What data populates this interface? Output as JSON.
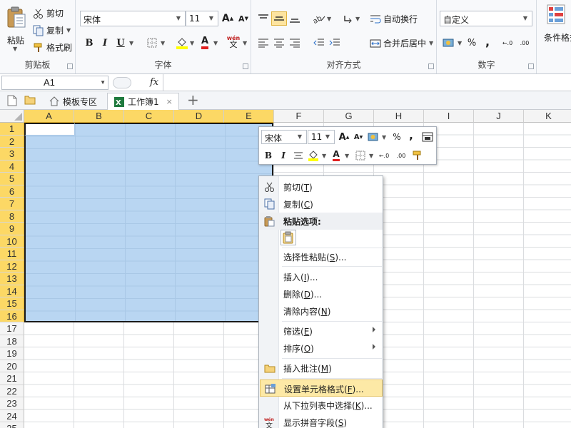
{
  "ribbon": {
    "clipboard": {
      "paste_label": "粘贴",
      "cut_label": "剪切",
      "copy_label": "复制",
      "format_painter_label": "格式刷",
      "group_label": "剪贴板"
    },
    "font": {
      "font_name": "宋体",
      "font_size": "11",
      "bold": "B",
      "italic": "I",
      "underline": "U",
      "font_color_glyph": "A",
      "wen_glyph": "wén",
      "group_label": "字体",
      "grow_label": "A",
      "shrink_label": "A"
    },
    "alignment": {
      "wrap_text_label": "自动换行",
      "merge_center_label": "合并后居中",
      "group_label": "对齐方式"
    },
    "number": {
      "format_value": "自定义",
      "percent": "%",
      "comma": ",",
      "inc_decimal": "←.0",
      "dec_decimal": ".00",
      "group_label": "数字"
    },
    "styles": {
      "conditional_format_label": "条件格式"
    }
  },
  "formula_bar": {
    "name_box": "A1",
    "fx": "fx",
    "formula": ""
  },
  "tabs": [
    {
      "label": "模板专区"
    },
    {
      "label": "工作簿1"
    }
  ],
  "sheet": {
    "columns": [
      "A",
      "B",
      "C",
      "D",
      "E",
      "F",
      "G",
      "H",
      "I",
      "J",
      "K"
    ],
    "selected_columns": [
      "A",
      "B",
      "C",
      "D",
      "E"
    ],
    "rows": [
      "1",
      "2",
      "3",
      "4",
      "5",
      "6",
      "7",
      "8",
      "9",
      "10",
      "11",
      "12",
      "13",
      "14",
      "15",
      "16",
      "17",
      "18",
      "19",
      "20",
      "21",
      "22",
      "23",
      "24",
      "25"
    ],
    "selected_rows_count": 16,
    "selection_color": "#b9d6f2",
    "header_selected_color": "#fcd865"
  },
  "mini_toolbar": {
    "font_name": "宋体",
    "font_size": "11",
    "percent": "%",
    "comma": ",",
    "bold": "B",
    "italic": "I",
    "font_color_glyph": "A"
  },
  "context_menu": {
    "items": [
      {
        "label": "剪切",
        "key": "T",
        "icon": "scissors-icon"
      },
      {
        "label": "复制",
        "key": "C",
        "icon": "copy-icon"
      },
      {
        "label": "粘贴选项:",
        "key": "",
        "icon": "paste-icon"
      },
      {
        "label": "选择性粘贴",
        "key": "S",
        "suffix": "...",
        "icon": ""
      },
      {
        "label": "插入",
        "key": "I",
        "suffix": "...",
        "icon": ""
      },
      {
        "label": "删除",
        "key": "D",
        "suffix": "...",
        "icon": ""
      },
      {
        "label": "清除内容",
        "key": "N",
        "icon": ""
      },
      {
        "label": "筛选",
        "key": "E",
        "icon": "",
        "submenu": true
      },
      {
        "label": "排序",
        "key": "O",
        "icon": "",
        "submenu": true
      },
      {
        "label": "插入批注",
        "key": "M",
        "icon": "comment-icon"
      },
      {
        "label": "设置单元格格式",
        "key": "F",
        "suffix": "...",
        "icon": "format-cells-icon",
        "highlighted": true
      },
      {
        "label": "从下拉列表中选择",
        "key": "K",
        "suffix": "...",
        "icon": ""
      },
      {
        "label": "显示拼音字段",
        "key": "S",
        "icon": "phonetic-icon"
      }
    ]
  }
}
